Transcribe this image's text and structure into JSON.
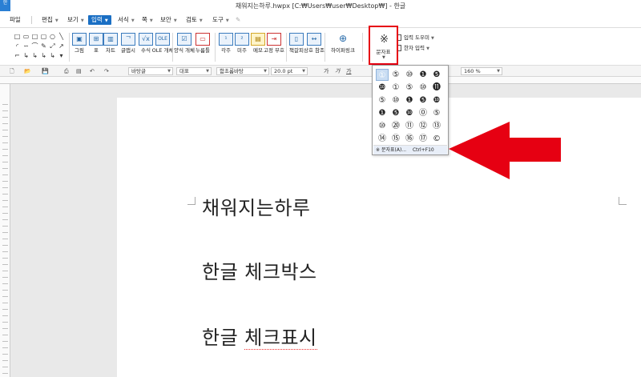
{
  "window": {
    "title": "채워지는하루.hwpx [C:₩Users₩user₩Desktop₩] - 한글",
    "app_icon_glyph": "한"
  },
  "menu": {
    "items": [
      {
        "label": "파일",
        "caret": false
      },
      {
        "label": "편집",
        "caret": true
      },
      {
        "label": "보기",
        "caret": true
      },
      {
        "label": "입력",
        "caret": true,
        "active": true
      },
      {
        "label": "서식",
        "caret": true
      },
      {
        "label": "쪽",
        "caret": true
      },
      {
        "label": "보안",
        "caret": true
      },
      {
        "label": "검토",
        "caret": true
      },
      {
        "label": "도구",
        "caret": true
      }
    ]
  },
  "ribbon": {
    "tools": [
      {
        "name": "picture",
        "label": "그림",
        "icon": "▣"
      },
      {
        "name": "table",
        "label": "표",
        "icon": "⊞"
      },
      {
        "name": "chart",
        "label": "차트",
        "icon": "▥"
      },
      {
        "name": "glyph-art",
        "label": "글맵시",
        "icon": "ᄀ"
      },
      {
        "name": "equation",
        "label": "수식",
        "icon": "√x"
      },
      {
        "name": "ole-object",
        "label": "OLE 개체",
        "icon": "OLE"
      },
      {
        "name": "form-object",
        "label": "양식 개체",
        "icon": "☑"
      },
      {
        "name": "push-button",
        "label": "누름틀",
        "icon": "▭"
      },
      {
        "name": "footnote",
        "label": "각주",
        "icon": "¹"
      },
      {
        "name": "endnote",
        "label": "미주",
        "icon": "²"
      },
      {
        "name": "memo",
        "label": "메모",
        "icon": "▤"
      },
      {
        "name": "fixed-tab",
        "label": "고정 부호",
        "icon": "⇥"
      },
      {
        "name": "bookmark",
        "label": "책갈피",
        "icon": "▯"
      },
      {
        "name": "cross-reference",
        "label": "상호 참조",
        "icon": "↔"
      },
      {
        "name": "hyperlink",
        "label": "하이퍼링크",
        "icon": "⊕"
      }
    ],
    "symbol": {
      "label": "문자표",
      "icon": "※"
    },
    "side_commands": [
      {
        "label": "입력 도우미"
      },
      {
        "label": "한자 입력"
      }
    ]
  },
  "format_bar": {
    "style": "바탕글",
    "lang": "대표",
    "font": "함초롬바탕",
    "size": "20.0",
    "unit": "pt",
    "zoom": "160",
    "zoom_unit": "%"
  },
  "document": {
    "lines": [
      {
        "text": "채워지는하루"
      },
      {
        "text": "한글 체크박스"
      },
      {
        "text": "한글 체크표시",
        "misspelled": "체크표시"
      }
    ]
  },
  "symbol_dropdown": {
    "rows": [
      [
        "①",
        "⑤",
        "⑩",
        "❶",
        "❺"
      ],
      [
        "❿",
        "①",
        "⑤",
        "⑩",
        "⓫"
      ],
      [
        "⑤",
        "⑩",
        "❶",
        "❺",
        "❿"
      ],
      [
        "❶",
        "❺",
        "❿",
        "⓪",
        "⑤"
      ],
      [
        "⑩",
        "⑳",
        "⑪",
        "⑫",
        "⑬"
      ],
      [
        "⑭",
        "⑮",
        "⑯",
        "⑰",
        "©"
      ]
    ],
    "menu_item": {
      "label": "문자표(A)...",
      "shortcut": "Ctrl+F10",
      "icon": "※"
    }
  },
  "colors": {
    "highlight": "#e60012",
    "menu_active": "#1a6fc4"
  }
}
